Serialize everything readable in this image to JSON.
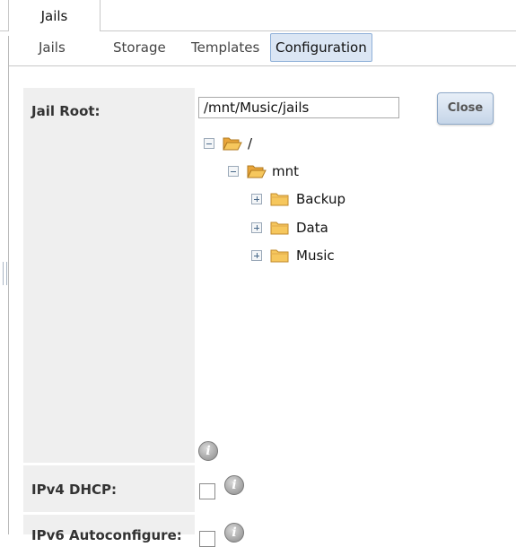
{
  "window": {
    "top_tab": "Jails"
  },
  "subtabs": [
    {
      "label": "Jails"
    },
    {
      "label": "Storage"
    },
    {
      "label": "Templates"
    },
    {
      "label": "Configuration",
      "active": true
    }
  ],
  "form": {
    "jail_root": {
      "label": "Jail Root:",
      "value": "/mnt/Music/jails",
      "close_label": "Close",
      "tree": [
        {
          "label": "/",
          "state": "expanded",
          "icon": "folder-open-icon"
        },
        {
          "label": "mnt",
          "state": "expanded",
          "icon": "folder-open-icon"
        },
        {
          "label": "Backup",
          "state": "collapsed",
          "icon": "folder-icon"
        },
        {
          "label": "Data",
          "state": "collapsed",
          "icon": "folder-icon"
        },
        {
          "label": "Music",
          "state": "collapsed",
          "icon": "folder-icon"
        }
      ]
    },
    "ipv4_dhcp": {
      "label": "IPv4 DHCP:",
      "checked": false
    },
    "ipv6_autoconfigure": {
      "label": "IPv6 Autoconfigure:",
      "checked": false
    }
  },
  "colors": {
    "label_bg": "#efefef",
    "active_tab_bg": "#dbe6f4",
    "button_border": "#8ea9c8",
    "folder": "#f2b84b"
  }
}
